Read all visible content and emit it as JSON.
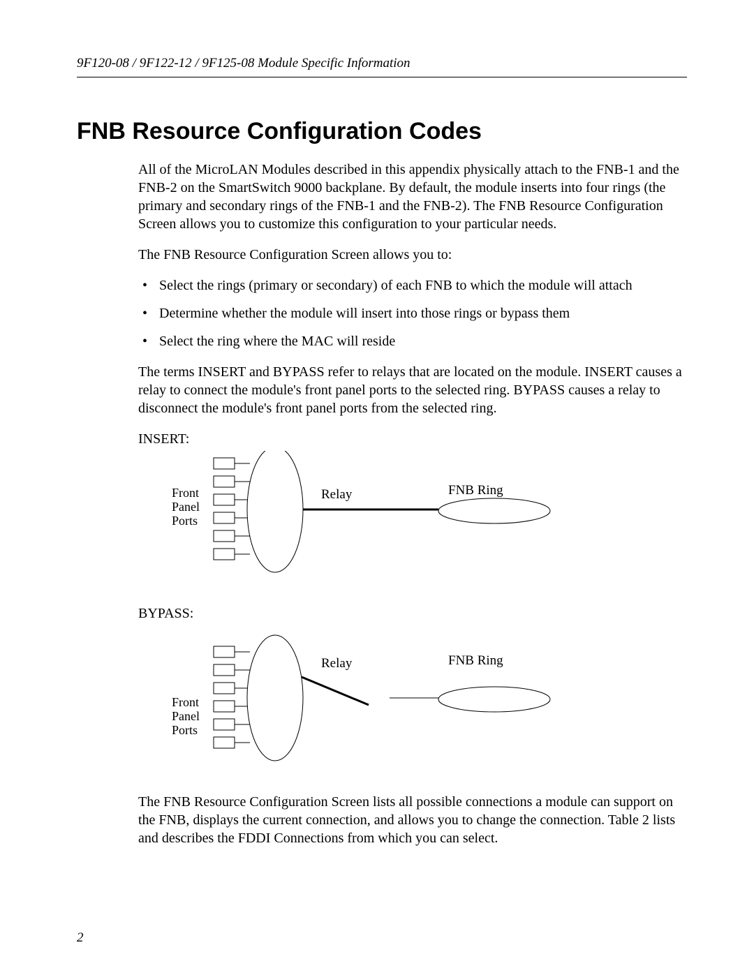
{
  "header": "9F120-08 / 9F122-12 / 9F125-08 Module Specific Information",
  "title": "FNB Resource Configuration Codes",
  "paragraph1": "All of the MicroLAN Modules described in this appendix physically attach to the FNB-1 and the FNB-2 on the SmartSwitch 9000 backplane. By default, the module inserts into four rings (the primary and secondary rings of the FNB-1 and the FNB-2). The FNB Resource Configuration Screen allows you to customize this configuration to your particular needs.",
  "paragraph2": "The FNB Resource Configuration Screen allows you to:",
  "bullets": {
    "b1": "Select the rings (primary or secondary) of each FNB to which the module will attach",
    "b2": "Determine whether the module will insert into those rings or bypass them",
    "b3": "Select the ring where the MAC will reside"
  },
  "paragraph3": "The terms INSERT and BYPASS refer to relays that are located on the module. INSERT causes a relay to connect the module's front panel ports to the selected ring. BYPASS causes a relay to disconnect the module's front panel ports from the selected ring.",
  "diagram": {
    "insertLabel": "INSERT:",
    "bypassLabel": "BYPASS:",
    "frontPanelPorts": "Front Panel Ports",
    "relay": "Relay",
    "fnbRing": "FNB Ring"
  },
  "paragraph4": "The FNB Resource Configuration Screen lists all possible connections a module can support on the FNB, displays the current connection, and allows you to change the connection. Table 2 lists and describes the FDDI Connections from which you can select.",
  "pageNumber": "2"
}
